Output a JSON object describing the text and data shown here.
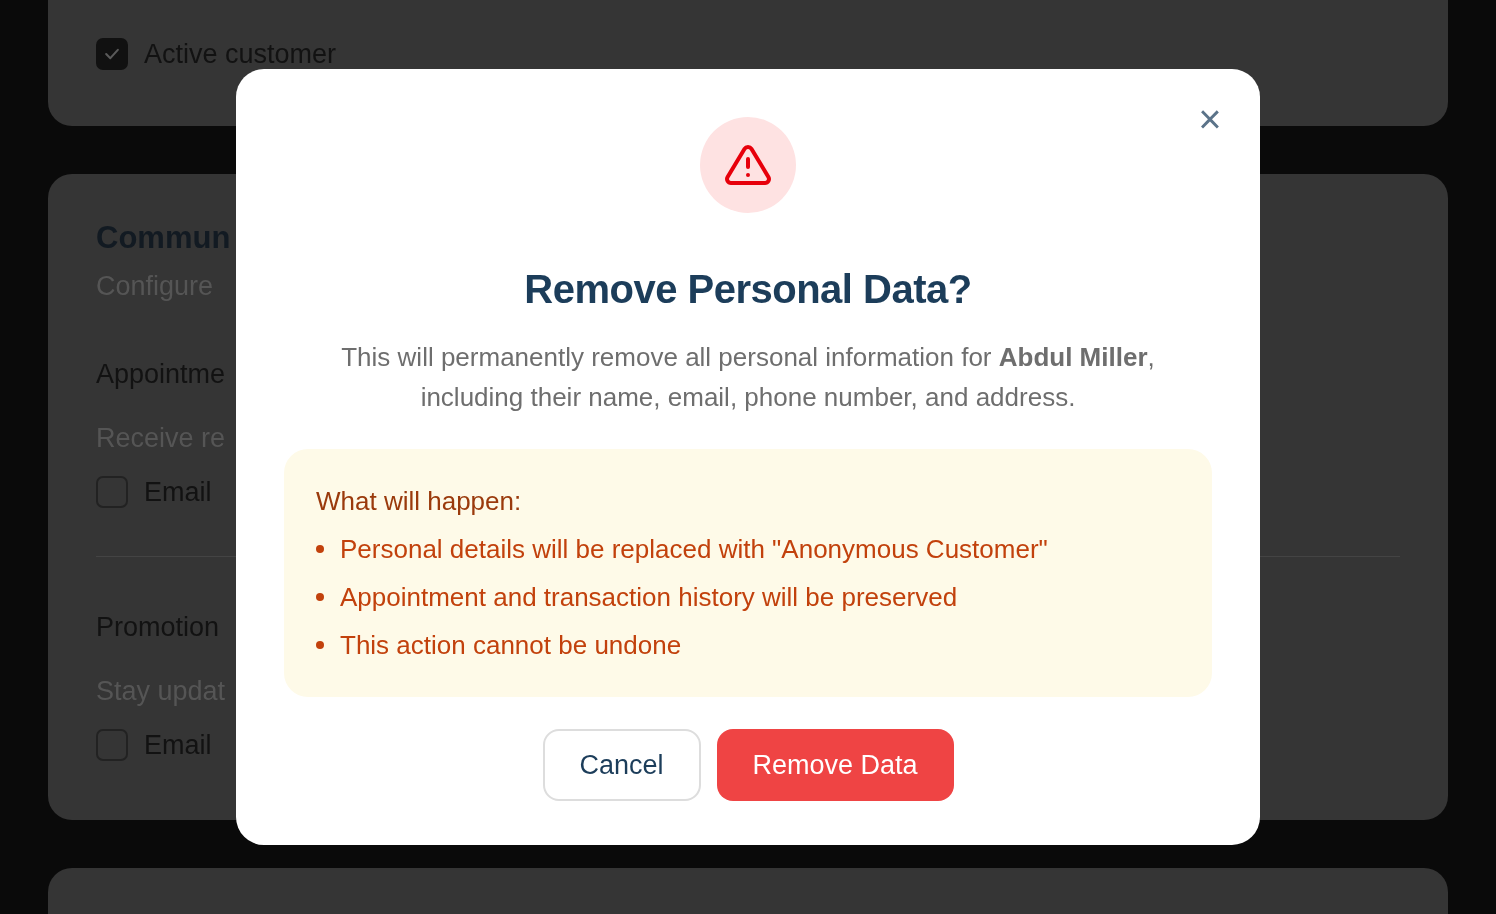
{
  "background": {
    "active_customer": {
      "label": "Active customer",
      "checked": true
    },
    "section": {
      "title": "Commun",
      "subtitle": "Configure",
      "groups": [
        {
          "title": "Appointme",
          "description": "Receive re",
          "option": {
            "label": "Email",
            "checked": false
          }
        },
        {
          "title": "Promotion",
          "description": "Stay updat",
          "option": {
            "label": "Email",
            "checked": false
          }
        }
      ]
    }
  },
  "dialog": {
    "close": "×",
    "title": "Remove Personal Data?",
    "message": "This will permanently remove all personal information for **Abdul Miller**, including their name, email, phone number, and address.",
    "notice": {
      "heading": "What will happen:",
      "items": [
        "Personal details will be replaced with \"Anonymous Customer\"",
        "Appointment and transaction history will be preserved",
        "This action cannot be undone"
      ]
    },
    "buttons": [
      {
        "label": "Cancel",
        "kind": "secondary"
      },
      {
        "label": "Remove Data",
        "kind": "danger"
      }
    ]
  }
}
